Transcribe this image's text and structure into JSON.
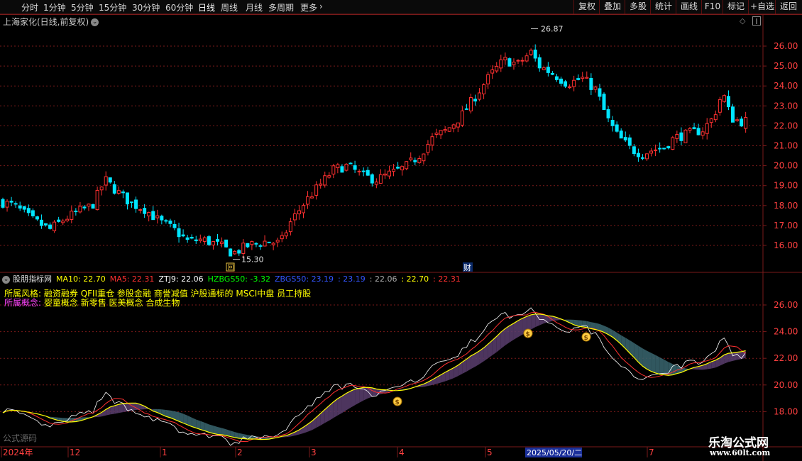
{
  "toolbar": {
    "left_items": [
      "分时",
      "1分钟",
      "5分钟",
      "15分钟",
      "30分钟",
      "60分钟",
      "日线",
      "周线",
      "月线",
      "多周期",
      "更多"
    ],
    "active_item": "日线",
    "right_items": [
      "复权",
      "叠加",
      "多股",
      "统计",
      "画线",
      "F10",
      "标记",
      "+自选",
      "返回"
    ]
  },
  "main_chart": {
    "title": "上海家化(日线,前复权)",
    "high_label": "26.87",
    "low_label": "15.30",
    "finance_marker": "财",
    "marker_box": "回",
    "price_ticks": [
      "26.00",
      "25.00",
      "24.00",
      "23.00",
      "22.00",
      "21.00",
      "20.00",
      "19.00",
      "18.00",
      "17.00",
      "16.00"
    ]
  },
  "indicator": {
    "name": "股朋指标网",
    "values": [
      {
        "label": "MA10: 22.70",
        "color": "#ffff00"
      },
      {
        "label": "MA5: 22.31",
        "color": "#ff3030"
      },
      {
        "label": "ZTJ9: 22.06",
        "color": "#ffffff"
      },
      {
        "label": "HZBGS50: -3.32",
        "color": "#00ff00"
      },
      {
        "label": "ZBGS50: 23.19",
        "color": "#3355ff"
      },
      {
        "label": ": 23.19",
        "color": "#3355ff"
      },
      {
        "label": ": 22.06",
        "color": "#aaaaaa"
      },
      {
        "label": ": 22.70",
        "color": "#ffff00"
      },
      {
        "label": ": 22.31",
        "color": "#ff3030"
      }
    ],
    "style_label": "所属风格:",
    "style_value": "融资融券 QFII重仓 参股金融 商誉减值 沪股通标的 MSCI中盘 员工持股",
    "concept_label": "所属概念:",
    "concept_value": "婴童概念 新零售 医美概念 合成生物",
    "source_label": "公式源码",
    "price_ticks": [
      "26.00",
      "24.00",
      "22.00",
      "20.00",
      "18.00"
    ]
  },
  "date_axis": {
    "labels": [
      "2024年",
      "12",
      "1",
      "2",
      "3",
      "4",
      "5",
      "7"
    ],
    "cursor_date": "2025/05/20/二"
  },
  "watermark": {
    "text": "乐淘公式网",
    "url": "www.60lt.com"
  },
  "colors": {
    "up": "#ff3030",
    "down": "#00e5ff",
    "grid": "#7a1a1a",
    "ma10": "#ffff00",
    "ma5": "#ff3030",
    "ztj9": "#ffffff",
    "band_up": "#5a3e6e",
    "band_down": "#3a6670"
  },
  "icons": [
    "chevron-down-icon",
    "chevron-right-icon",
    "diamond-icon",
    "pause-icon",
    "money-bag-icon"
  ]
}
